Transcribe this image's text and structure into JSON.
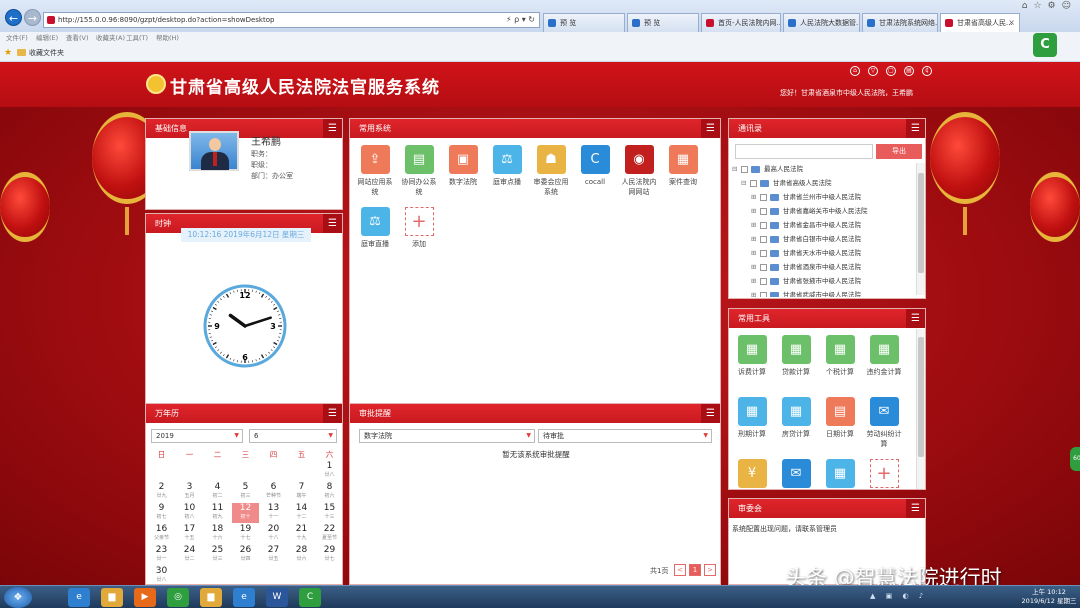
{
  "browser": {
    "url": "http://155.0.0.96:8090/gzpt/desktop.do?action=showDesktop",
    "tabs": [
      {
        "label": "预 览",
        "color": "#2a6fc9"
      },
      {
        "label": "预 览",
        "color": "#2a6fc9"
      },
      {
        "label": "首页-人民法院内网...",
        "color": "#c8102e"
      },
      {
        "label": "人民法院大数据管...",
        "color": "#2a6fc9"
      },
      {
        "label": "甘肃法院系统网络...",
        "color": "#2a6fc9"
      },
      {
        "label": "甘肃省高级人民...",
        "color": "#c8102e"
      }
    ],
    "menu": [
      "文件(F)",
      "编辑(E)",
      "查看(V)",
      "收藏夹(A)",
      "工具(T)",
      "帮助(H)"
    ],
    "favorites_label": "收藏文件夹",
    "ext_icon": "C"
  },
  "header": {
    "title": "甘肃省高级人民法院法官服务系统",
    "welcome": "您好！甘肃省酒泉市中级人民法院，王希鹏",
    "tools": [
      "home-icon",
      "shirt-icon",
      "lock-icon",
      "trash-icon",
      "currency-icon"
    ]
  },
  "profile": {
    "title": "基础信息",
    "name": "王希鹏",
    "position": "职务：",
    "rank": "职级：",
    "department": "部门：办公室"
  },
  "clock": {
    "title": "时钟",
    "datetime": "10:12:16  2019年6月12日 星期三",
    "hour": 10,
    "minute": 12,
    "numerals": [
      "12",
      "3",
      "6",
      "9"
    ]
  },
  "apps": {
    "title": "常用系统",
    "items": [
      {
        "label": "网站应用系统",
        "icon": "upload-icon",
        "color": "#ef7a5a",
        "glyph": "⇪"
      },
      {
        "label": "协同办公系统",
        "icon": "clipboard-icon",
        "color": "#6cc06a",
        "glyph": "▤"
      },
      {
        "label": "数字法院",
        "icon": "tv-icon",
        "color": "#ef7a5a",
        "glyph": "▣"
      },
      {
        "label": "庭审点播",
        "icon": "gavel-icon",
        "color": "#4cb4e6",
        "glyph": "⚖"
      },
      {
        "label": "审委会应用系统",
        "icon": "group-icon",
        "color": "#e9b443",
        "glyph": "☗"
      },
      {
        "label": "cocall",
        "icon": "cocall-icon",
        "color": "#2a8bd8",
        "glyph": "C"
      },
      {
        "label": "人民法院内网网站",
        "icon": "emblem-icon",
        "color": "#c21f1f",
        "glyph": "◉"
      },
      {
        "label": "案件查询",
        "icon": "monitor-icon",
        "color": "#ef7a5a",
        "glyph": "▦"
      },
      {
        "label": "庭审直播",
        "icon": "gavel-icon",
        "color": "#4cb4e6",
        "glyph": "⚖"
      }
    ],
    "add_label": "添加"
  },
  "contacts": {
    "title": "通讯录",
    "button": "导出",
    "root": "最高人民法院",
    "child": "甘肃省高级人民法院",
    "items": [
      "甘肃省兰州市中级人民法院",
      "甘肃省嘉峪关市中级人民法院",
      "甘肃省金昌市中级人民法院",
      "甘肃省白银市中级人民法院",
      "甘肃省天水市中级人民法院",
      "甘肃省酒泉市中级人民法院",
      "甘肃省张掖市中级人民法院",
      "甘肃省武威市中级人民法院"
    ]
  },
  "tools": {
    "title": "常用工具",
    "items": [
      {
        "label": "诉费计算",
        "icon": "calc-icon",
        "color": "#6cc06a"
      },
      {
        "label": "贷款计算",
        "icon": "calc-icon",
        "color": "#6cc06a"
      },
      {
        "label": "个税计算",
        "icon": "calc-icon",
        "color": "#6cc06a"
      },
      {
        "label": "违约金计算",
        "icon": "calc-icon",
        "color": "#6cc06a"
      },
      {
        "label": "刑期计算",
        "icon": "calc-icon",
        "color": "#4cb4e6"
      },
      {
        "label": "房贷计算",
        "icon": "calc-icon",
        "color": "#4cb4e6"
      },
      {
        "label": "日期计算",
        "icon": "calendar-icon",
        "color": "#ef7a5a"
      },
      {
        "label": "劳动纠纷计算",
        "icon": "chat-icon",
        "color": "#2a8bd8"
      },
      {
        "label": "",
        "icon": "yen-icon",
        "color": "#e9b443"
      },
      {
        "label": "",
        "icon": "chat-icon",
        "color": "#2a8bd8"
      },
      {
        "label": "",
        "icon": "calc-icon",
        "color": "#4cb4e6"
      }
    ]
  },
  "calendar": {
    "title": "万年历",
    "year": "2019",
    "month": "6",
    "weekdays": [
      "日",
      "一",
      "二",
      "三",
      "四",
      "五",
      "六"
    ],
    "today": "12",
    "days": [
      {
        "d": "1",
        "l": "廿八"
      },
      {
        "d": "2",
        "l": "廿九"
      },
      {
        "d": "3",
        "l": "五月"
      },
      {
        "d": "4",
        "l": "初二"
      },
      {
        "d": "5",
        "l": "初三"
      },
      {
        "d": "6",
        "l": "芒种节"
      },
      {
        "d": "7",
        "l": "端午"
      },
      {
        "d": "8",
        "l": "初六"
      },
      {
        "d": "9",
        "l": "初七"
      },
      {
        "d": "10",
        "l": "初八"
      },
      {
        "d": "11",
        "l": "初九"
      },
      {
        "d": "12",
        "l": "初十"
      },
      {
        "d": "13",
        "l": "十一"
      },
      {
        "d": "14",
        "l": "十二"
      },
      {
        "d": "15",
        "l": "十三"
      },
      {
        "d": "16",
        "l": "父亲节"
      },
      {
        "d": "17",
        "l": "十五"
      },
      {
        "d": "18",
        "l": "十六"
      },
      {
        "d": "19",
        "l": "十七"
      },
      {
        "d": "20",
        "l": "十八"
      },
      {
        "d": "21",
        "l": "十九"
      },
      {
        "d": "22",
        "l": "夏至节"
      },
      {
        "d": "23",
        "l": "廿一"
      },
      {
        "d": "24",
        "l": "廿二"
      },
      {
        "d": "25",
        "l": "廿三"
      },
      {
        "d": "26",
        "l": "廿四"
      },
      {
        "d": "27",
        "l": "廿五"
      },
      {
        "d": "28",
        "l": "廿六"
      },
      {
        "d": "29",
        "l": "廿七"
      },
      {
        "d": "30",
        "l": "廿八"
      }
    ]
  },
  "approvals": {
    "title": "审批提醒",
    "filter1": "数字法院",
    "filter2": "待审批",
    "empty": "暂无该系统审批提醒",
    "pager": "共1页",
    "page": "1",
    "prev": "<",
    "next": ">"
  },
  "committee": {
    "title": "审委会",
    "message": "系统配置出现问题，请联系管理员"
  },
  "taskbar": {
    "time": "上午 10:12",
    "date": "2019/6/12 星期三",
    "start": "❖",
    "apps": [
      {
        "icon": "ie-icon",
        "color": "#2f7fd0",
        "glyph": "e"
      },
      {
        "icon": "folder-icon",
        "color": "#e0a93a",
        "glyph": "▆"
      },
      {
        "icon": "media-icon",
        "color": "#e66a1a",
        "glyph": "▶"
      },
      {
        "icon": "app-icon",
        "color": "#2e9e3e",
        "glyph": "◎"
      },
      {
        "icon": "folder-icon",
        "color": "#e0a93a",
        "glyph": "▆"
      },
      {
        "icon": "ie-icon",
        "color": "#2f7fd0",
        "glyph": "e"
      },
      {
        "icon": "word-icon",
        "color": "#2b579a",
        "glyph": "W"
      },
      {
        "icon": "cocall-icon",
        "color": "#2e9e3e",
        "glyph": "C"
      }
    ]
  },
  "watermark": "头条 @智慧法院进行时",
  "side_badge": "60"
}
